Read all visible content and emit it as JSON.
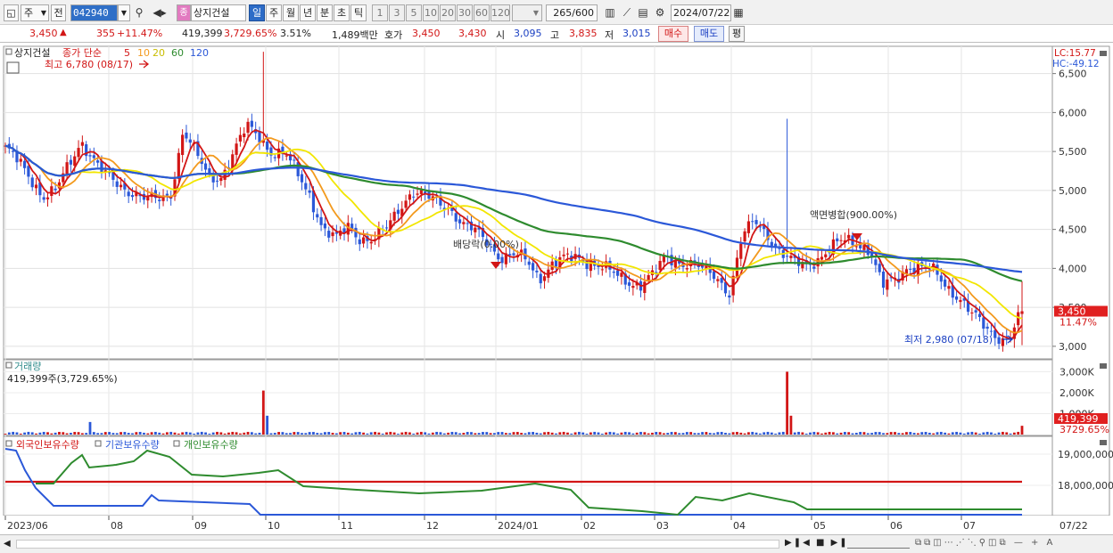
{
  "toolbar": {
    "market": "주",
    "prev": "전",
    "code": "042940",
    "name": "상지건설",
    "name_badge": "종",
    "periods": [
      "일",
      "주",
      "월",
      "년",
      "분",
      "초",
      "틱"
    ],
    "selected_period": "일",
    "intervals": [
      "1",
      "3",
      "5",
      "10",
      "20",
      "30",
      "60",
      "120"
    ],
    "count": "265",
    "count_total": "/600",
    "date": "2024/07/22"
  },
  "quote": {
    "price": "3,450",
    "change": "355",
    "change_pct": "+11.47%",
    "volume": "419,399",
    "volume_pct": "3,729.65%",
    "turnover": "3.51%",
    "amount": "1,489백만",
    "bid_label": "호가",
    "ask": "3,450",
    "bid": "3,430",
    "open_label": "시",
    "open": "3,095",
    "high_label": "고",
    "high": "3,835",
    "low_label": "저",
    "low": "3,015",
    "buy_button": "매수",
    "sell_button": "매도",
    "eval_button": "평"
  },
  "legend": {
    "name": "상지건설",
    "series_label": "종가 단순",
    "ma": [
      {
        "label": "5",
        "color": "#d21616"
      },
      {
        "label": "10",
        "color": "#f39a1e"
      },
      {
        "label": "20",
        "color": "#f2e600"
      },
      {
        "label": "60",
        "color": "#2e8b2e"
      },
      {
        "label": "120",
        "color": "#2b58d8"
      }
    ],
    "lc": "LC:15.77",
    "hc": "HC:-49.12"
  },
  "annotations": {
    "high": "최고 6,780 (08/17)",
    "low": "최저 2,980 (07/18)",
    "dividend": "배당락(0.00%)",
    "merge": "액면병합(900.00%)"
  },
  "price_axis": [
    "6,500",
    "6,000",
    "5,500",
    "5,000",
    "4,500",
    "4,000",
    "3,500",
    "3,000"
  ],
  "last_price_tag": "3,450",
  "last_pct_tag": "11.47%",
  "volume_pane": {
    "title": "거래량",
    "value": "419,399주(3,729.65%)",
    "axis": [
      "3,000K",
      "2,000K",
      "1,000K"
    ],
    "tag": "419,399",
    "tag_pct": "3729.65%"
  },
  "holdings_pane": {
    "series": [
      {
        "name": "외국인보유수량",
        "color": "#d21616"
      },
      {
        "name": "기관보유수량",
        "color": "#2b58d8"
      },
      {
        "name": "개인보유수량",
        "color": "#2e8b2e"
      }
    ],
    "axis": [
      "19,000,000",
      "18,000,000"
    ]
  },
  "x_axis": [
    "2023/06",
    "08",
    "09",
    "10",
    "11",
    "12",
    "2024/01",
    "02",
    "03",
    "04",
    "05",
    "06",
    "07"
  ],
  "x_axis_right": "07/22",
  "chart_data": {
    "type": "candlestick",
    "date_range": [
      "2023/06",
      "2024/07/22"
    ],
    "ylim": [
      2850,
      6850
    ],
    "price_ticks": [
      3000,
      3500,
      4000,
      4500,
      5000,
      5500,
      6000,
      6500
    ],
    "close_profile": [
      5550,
      5350,
      5150,
      4950,
      5000,
      5300,
      5650,
      5400,
      5150,
      5050,
      5000,
      4900,
      4850,
      4950,
      5800,
      5450,
      5150,
      5200,
      5500,
      5800,
      5700,
      5500,
      5450,
      5200,
      4950,
      4500,
      4350,
      4550,
      4400,
      4350,
      4500,
      4800,
      5000,
      4900,
      4850,
      4800,
      4550,
      4450,
      4350,
      4150,
      4150,
      4100,
      3900,
      4050,
      4100,
      4150,
      4100,
      4000,
      3900,
      3850,
      3800,
      3900,
      4150,
      4100,
      4050,
      3950,
      3900,
      3700,
      4400,
      4600,
      4450,
      4200,
      4050,
      4050,
      4150,
      4250,
      4350,
      4350,
      4250,
      3750,
      3850,
      4050,
      4000,
      3950,
      3800,
      3650,
      3400,
      3250,
      3150,
      3100,
      3450
    ],
    "ma_end_values": {
      "ma5": 3150,
      "ma20": 3280,
      "ma60": 3780,
      "ma120": 3930
    },
    "volume_k": {
      "peak_aug": 2100,
      "peak_mar": 3000,
      "last": 419
    }
  }
}
